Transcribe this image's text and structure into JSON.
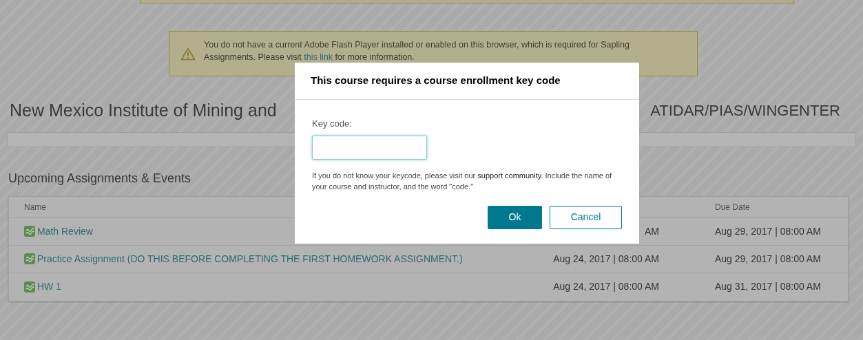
{
  "warning": {
    "text": "You do not have a current Adobe Flash Player installed or enabled on this browser, which is required for Sapling Assignments. Please visit",
    "link": "this link",
    "after": "for more information."
  },
  "course_title": {
    "left": "New Mexico Institute of Mining and",
    "right": "ATIDAR/PIAS/WINGENTER"
  },
  "section_title": "Upcoming Assignments & Events",
  "table": {
    "columns": [
      "Name",
      "",
      "Due Date"
    ],
    "rows": [
      {
        "name": "Math Review",
        "available": "AM",
        "due": "Aug 29, 2017 | 08:00 AM"
      },
      {
        "name": "Practice Assignment (DO THIS BEFORE COMPLETING THE FIRST HOMEWORK ASSIGNMENT.)",
        "available": "Aug 24, 2017 | 08:00 AM",
        "due": "Aug 29, 2017 | 08:00 AM"
      },
      {
        "name": "HW 1",
        "available": "Aug 24, 2017 | 08:00 AM",
        "due": "Aug 31, 2017 | 08:00 AM"
      }
    ]
  },
  "dialog": {
    "title": "This course requires a course enrollment key code",
    "label": "Key code:",
    "help_before": "If you do not know your keycode, please visit our",
    "help_link": "support community",
    "help_after": ". Include the name of your course and instructor, and the word \"code.\"",
    "buttons": [
      {
        "label": "Ok",
        "kind": "primary"
      },
      {
        "label": "Cancel",
        "kind": "secondary"
      }
    ]
  }
}
